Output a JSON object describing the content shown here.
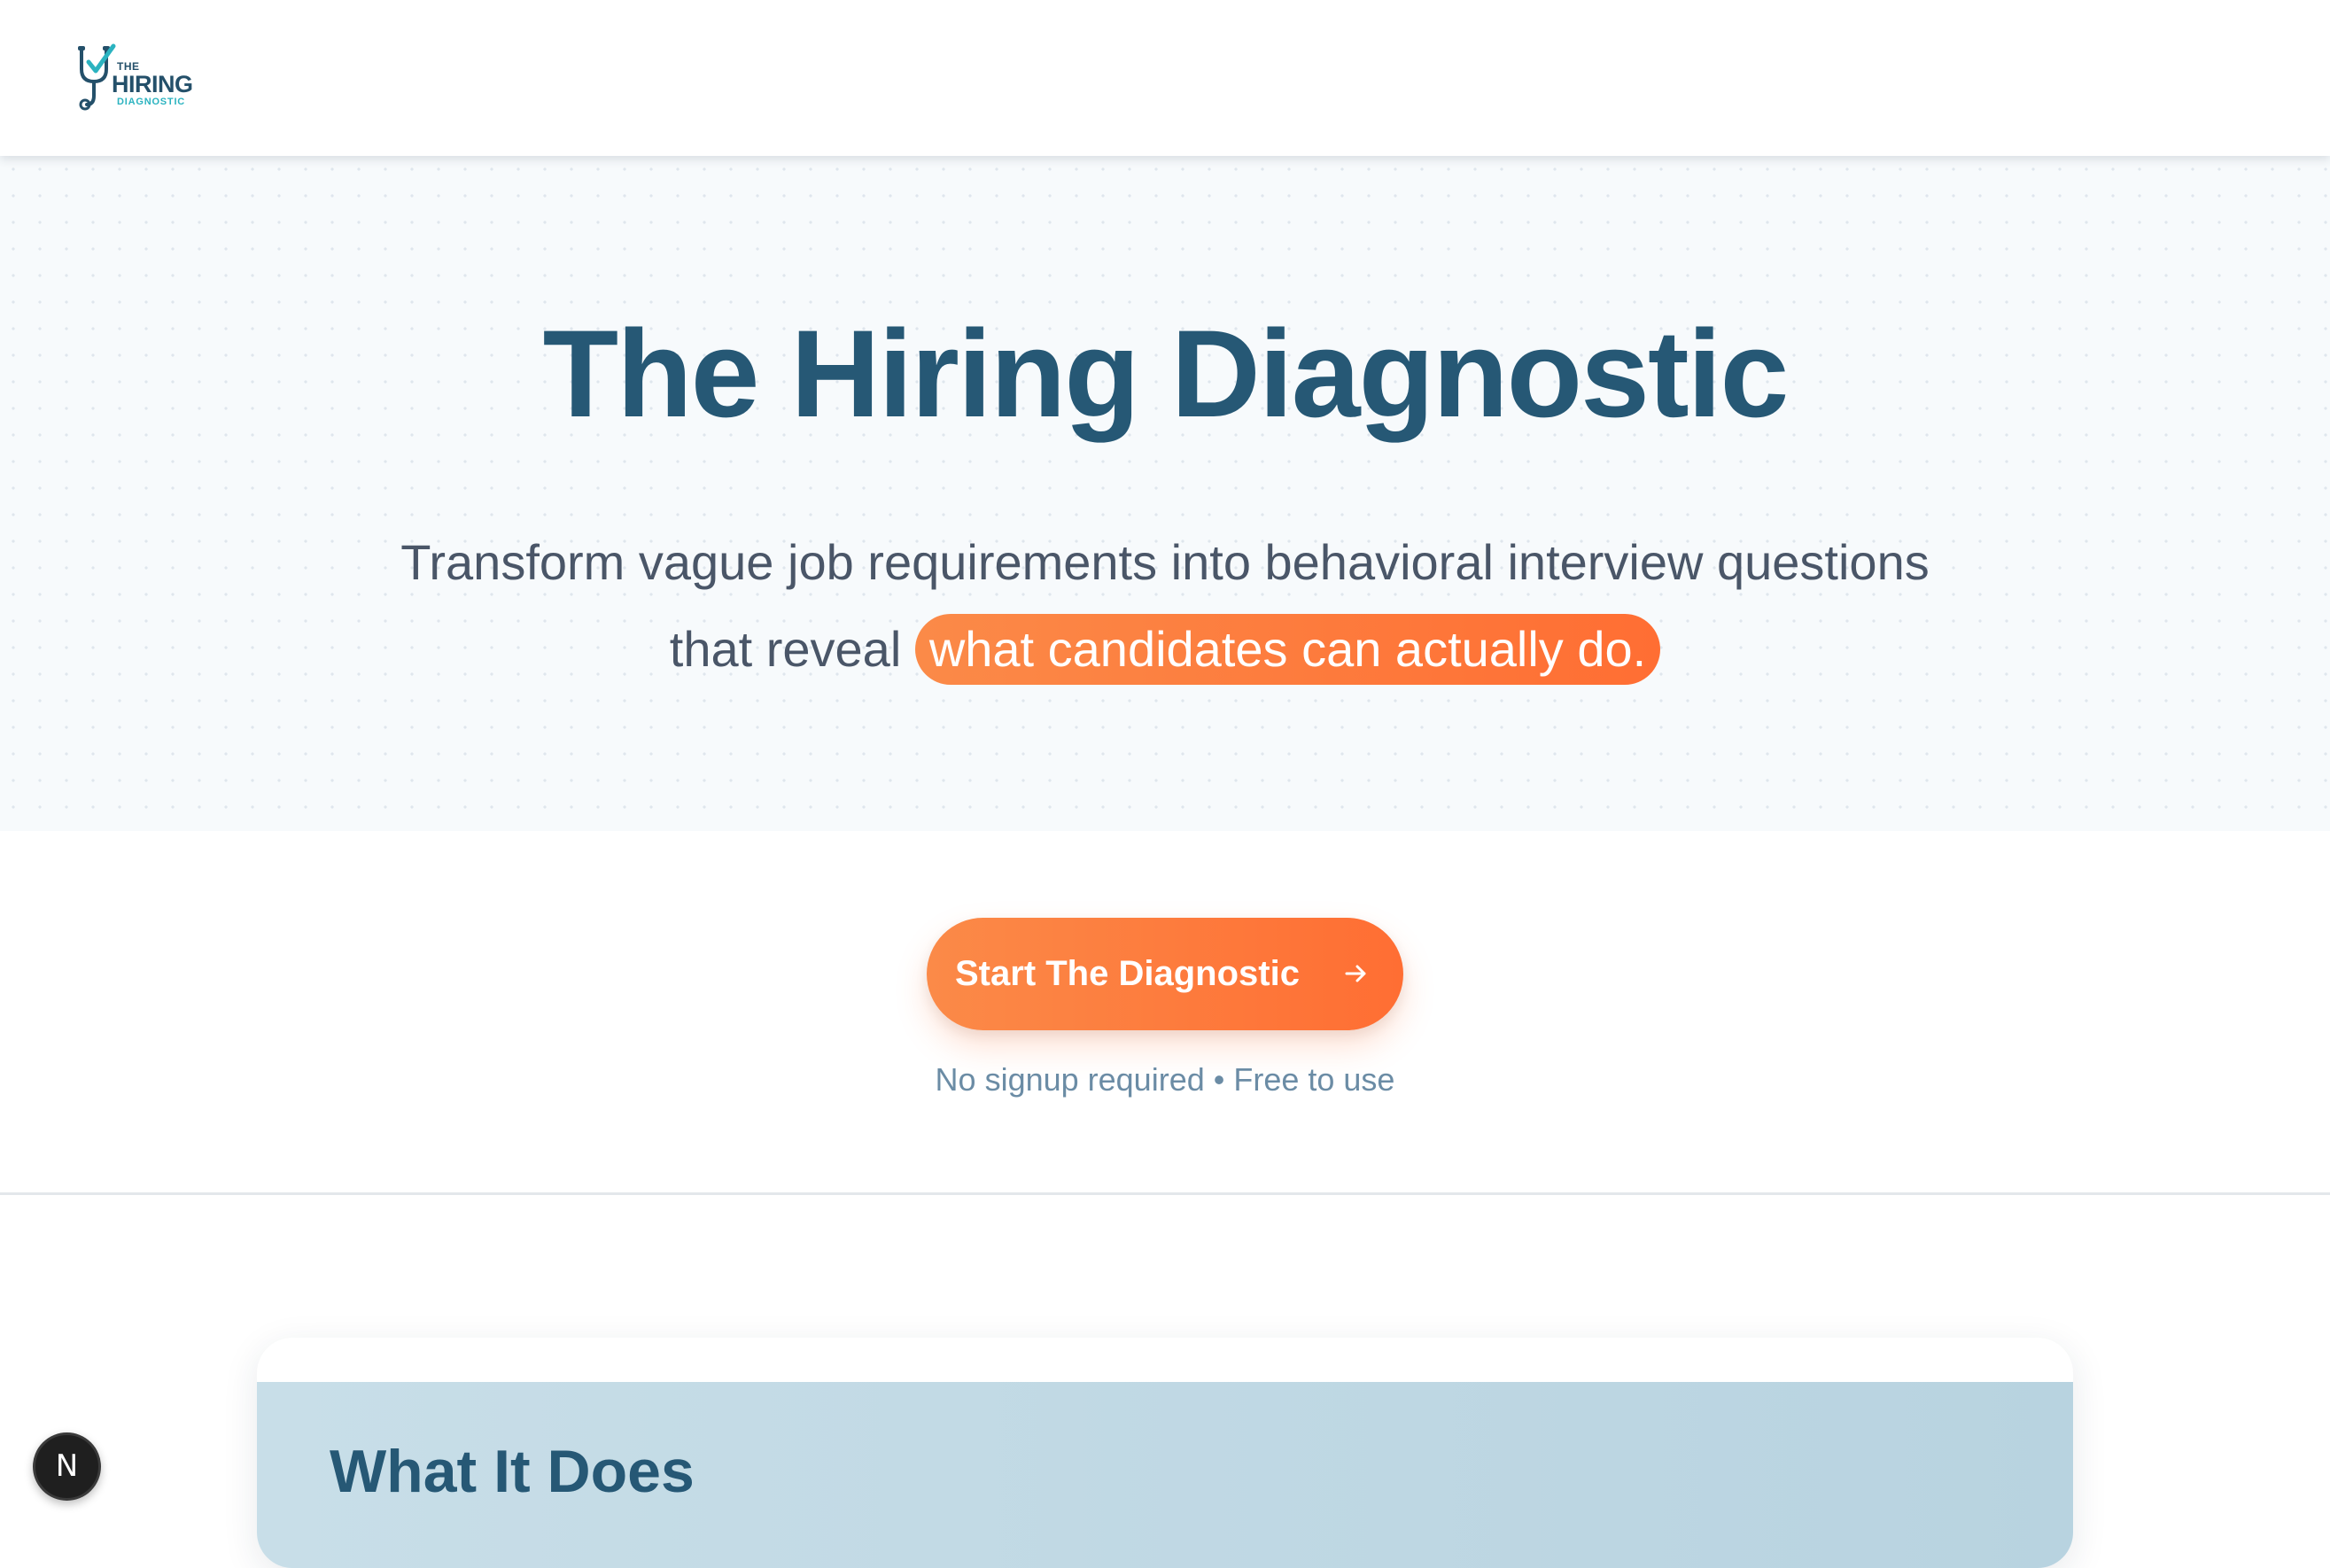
{
  "header": {
    "logo": {
      "line1": "THE",
      "line2": "HIRING",
      "line3": "DIAGNOSTIC",
      "icon": "stethoscope-check-icon"
    }
  },
  "hero": {
    "title": "The Hiring Diagnostic",
    "subtitle_part1": "Transform vague job requirements into behavioral interview questions that reveal ",
    "subtitle_highlight": "what candidates can actually do."
  },
  "cta": {
    "label": "Start The Diagnostic",
    "icon": "arrow-right-icon",
    "note": "No signup required • Free to use"
  },
  "section": {
    "title": "What It Does"
  },
  "floating_button": {
    "label": "N"
  },
  "colors": {
    "primary": "#265875",
    "accent": "#ff6e33",
    "teal": "#2bb3c0"
  }
}
